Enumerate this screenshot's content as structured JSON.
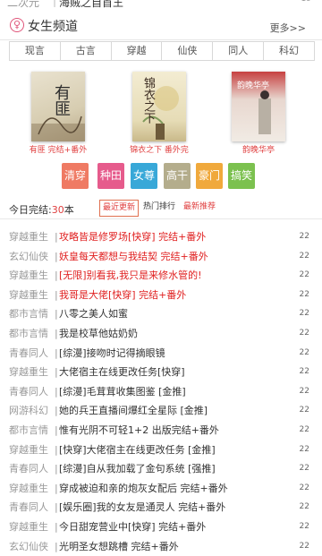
{
  "top_strip": {
    "category": "二次元",
    "title": "海贼之自首王",
    "num": "19"
  },
  "channel": {
    "icon": "female-icon",
    "title": "女生频道",
    "more": "更多>>"
  },
  "subtabs": [
    "现言",
    "古言",
    "穿越",
    "仙侠",
    "同人",
    "科幻"
  ],
  "covers": [
    {
      "caption": "有匪 完结+番外",
      "cover_text": "有匪"
    },
    {
      "caption": "锦衣之下 番外完",
      "cover_text": "锦衣之下"
    },
    {
      "caption": "韵晚华亭",
      "cover_text": "韵晚华亭"
    }
  ],
  "genres": [
    {
      "label": "清穿",
      "color": "#ef7a63"
    },
    {
      "label": "种田",
      "color": "#e65b8c"
    },
    {
      "label": "女尊",
      "color": "#38a8d8"
    },
    {
      "label": "高干",
      "color": "#b4ad8c"
    },
    {
      "label": "豪门",
      "color": "#f0a93c"
    },
    {
      "label": "搞笑",
      "color": "#7cc14f"
    }
  ],
  "updates": {
    "today_label": "今日完结:",
    "today_count": "30",
    "today_unit": "本",
    "tabs": [
      "最近更新",
      "热门排行",
      "最新推荐"
    ]
  },
  "books": [
    {
      "category": "穿越重生",
      "title": "攻略皆是修罗场[快穿] 完结+番外",
      "num": "22",
      "red": true
    },
    {
      "category": "玄幻仙侠",
      "title": "妖皇每天都想与我结契 完结+番外",
      "num": "22",
      "red": true
    },
    {
      "category": "穿越重生",
      "title": "[无限]别看我,我只是来修水管的!",
      "num": "22",
      "red": true
    },
    {
      "category": "穿越重生",
      "title": "我哥是大佬[快穿] 完结+番外",
      "num": "22",
      "red": true
    },
    {
      "category": "都市言情",
      "title": "八零之美人如蜜",
      "num": "22",
      "red": false
    },
    {
      "category": "都市言情",
      "title": "我是校草他姑奶奶",
      "num": "22",
      "red": false
    },
    {
      "category": "青春同人",
      "title": "[综漫]接吻时记得摘眼镜",
      "num": "22",
      "red": false
    },
    {
      "category": "穿越重生",
      "title": "大佬宿主在线更改任务[快穿]",
      "num": "22",
      "red": false
    },
    {
      "category": "青春同人",
      "title": "[综漫]毛茸茸收集图鉴 [金推]",
      "num": "22",
      "red": false
    },
    {
      "category": "网游科幻",
      "title": "她的兵王直播间爆红全星际 [金推]",
      "num": "22",
      "red": false
    },
    {
      "category": "都市言情",
      "title": "惟有光阴不可轻1+2 出版完结+番外",
      "num": "22",
      "red": false
    },
    {
      "category": "穿越重生",
      "title": "[快穿]大佬宿主在线更改任务 [金推]",
      "num": "22",
      "red": false
    },
    {
      "category": "青春同人",
      "title": "[综漫]自从我加载了金句系统 [强推]",
      "num": "22",
      "red": false
    },
    {
      "category": "穿越重生",
      "title": "穿成被迫和亲的炮灰女配后 完结+番外",
      "num": "22",
      "red": false
    },
    {
      "category": "青春同人",
      "title": "[娱乐圈]我的女友是通灵人 完结+番外",
      "num": "22",
      "red": false
    },
    {
      "category": "穿越重生",
      "title": "今日甜宠营业中[快穿] 完结+番外",
      "num": "22",
      "red": false
    },
    {
      "category": "玄幻仙侠",
      "title": "光明圣女想跳槽 完结+番外",
      "num": "22",
      "red": false
    }
  ]
}
